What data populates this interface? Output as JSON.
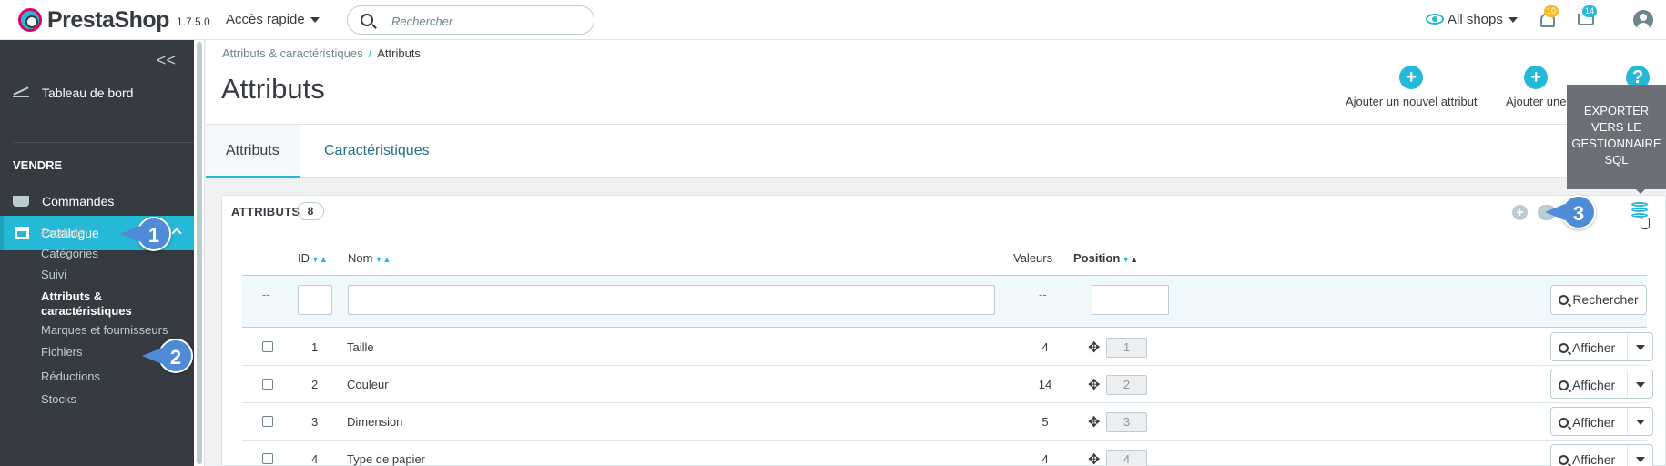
{
  "header": {
    "brand": "PrestaShop",
    "version": "1.7.5.0",
    "quick_access": "Accès rapide",
    "search_placeholder": "Rechercher",
    "shops": "All shops",
    "notif_bell_count": "10",
    "notif_cart_count": "14"
  },
  "sidebar": {
    "collapse": "<<",
    "dashboard": "Tableau de bord",
    "section_sell": "VENDRE",
    "orders": "Commandes",
    "catalog": "Catalogue",
    "sub_items": [
      "Produits",
      "Catégories",
      "Suivi",
      "Attributs & caractéristiques",
      "Marques et fournisseurs",
      "Fichiers",
      "Réductions",
      "Stocks"
    ]
  },
  "callouts": [
    "1",
    "2",
    "3"
  ],
  "breadcrumb": {
    "parent": "Attributs & caractéristiques",
    "separator": "/",
    "current": "Attributs"
  },
  "page_title": "Attributs",
  "toolbar": {
    "add_attribute": "Ajouter un nouvel attribut",
    "add_value": "Ajouter une",
    "add_icon": "+",
    "help_icon": "?"
  },
  "tooltip": "EXPORTER VERS LE GESTIONNAIRE SQL",
  "tabs": [
    "Attributs",
    "Caractéristiques"
  ],
  "panel": {
    "title": "ATTRIBUTS",
    "count": "8",
    "columns": {
      "id": "ID",
      "name": "Nom",
      "values": "Valeurs",
      "position": "Position"
    },
    "filter_placeholder": "--",
    "search_button": "Rechercher",
    "view_button": "Afficher",
    "rows": [
      {
        "id": "1",
        "name": "Taille",
        "values": "4",
        "position": "1"
      },
      {
        "id": "2",
        "name": "Couleur",
        "values": "14",
        "position": "2"
      },
      {
        "id": "3",
        "name": "Dimension",
        "values": "5",
        "position": "3"
      },
      {
        "id": "4",
        "name": "Type de papier",
        "values": "4",
        "position": "4"
      }
    ]
  },
  "colors": {
    "accent": "#25b9d7",
    "sidebar": "#363a41",
    "callout": "#4f8bd6"
  }
}
